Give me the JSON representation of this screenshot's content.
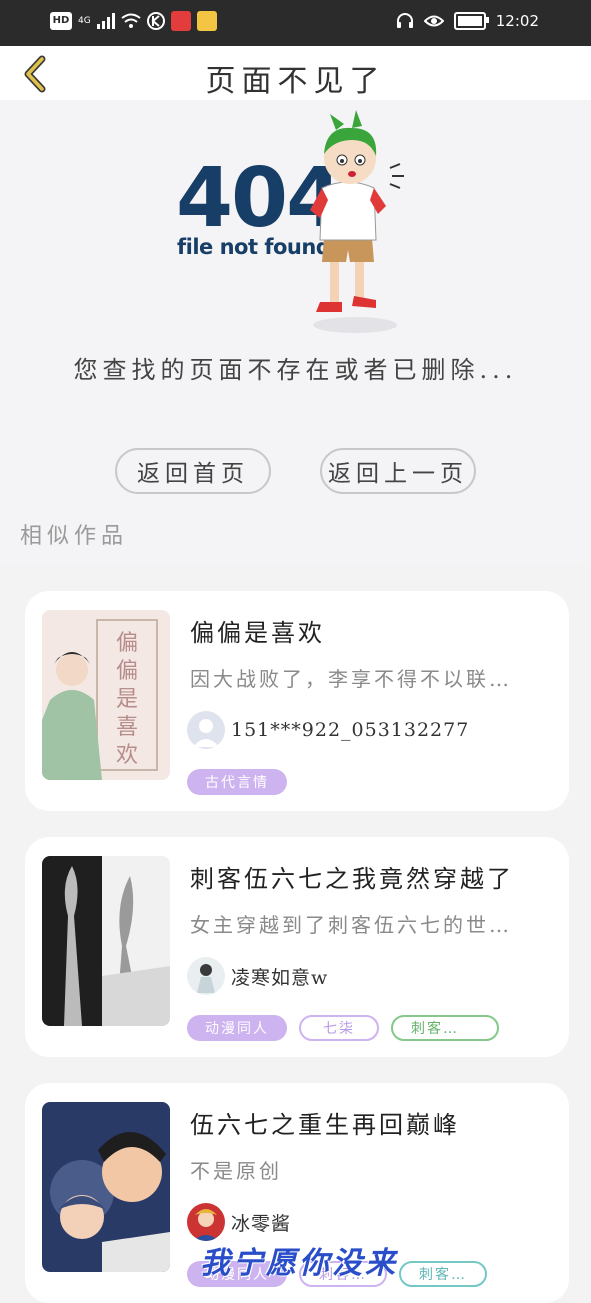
{
  "status_bar": {
    "left_chips": [
      "HD",
      "4G"
    ],
    "time": "12:02"
  },
  "nav": {
    "title": "页面不见了"
  },
  "error": {
    "code": "404",
    "subtitle": "file not found",
    "message": "您查找的页面不存在或者已删除..."
  },
  "buttons": {
    "home": "返回首页",
    "back": "返回上一页"
  },
  "similar_label": "相似作品",
  "works": [
    {
      "title": "偏偏是喜欢",
      "desc": "因大战败了，李享不得不以联…",
      "author": "151***922_053132277",
      "tags": [
        "古代言情"
      ]
    },
    {
      "title": "刺客伍六七之我竟然穿越了",
      "desc": "女主穿越到了刺客伍六七的世…",
      "author": "凌寒如意w",
      "tags": [
        "动漫同人",
        "七柒",
        "刺客…"
      ]
    },
    {
      "title": "伍六七之重生再回巅峰",
      "desc": "不是原创",
      "author": "冰零酱",
      "tags": [
        "动漫同人",
        "刺客…",
        "刺客…"
      ]
    }
  ],
  "watermark": "我宁愿你没来",
  "colors": {
    "accent_purple": "#cdb3f0",
    "tag_green": "#85c88a",
    "tag_teal": "#73c8c6",
    "error_blue": "#163e66",
    "back_arrow": "#e0c24a"
  }
}
